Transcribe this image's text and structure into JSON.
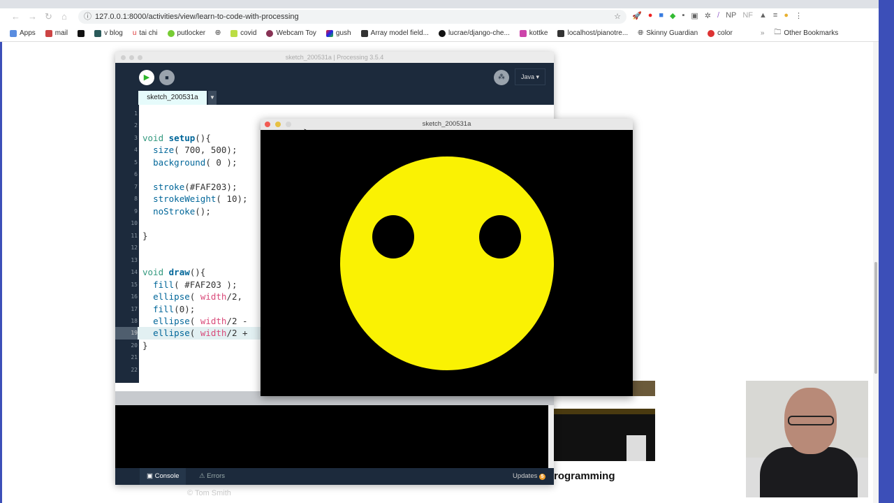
{
  "browser": {
    "url": "127.0.0.1:8000/activities/view/learn-to-code-with-processing",
    "bookmarks": [
      "Apps",
      "mail",
      "",
      "v blog",
      "tai chi",
      "putlocker",
      "",
      "covid",
      "Webcam Toy",
      "gush",
      "Array model field...",
      "lucrae/django-che...",
      "kottke",
      "localhost/pianotre...",
      "Skinny Guardian",
      "color"
    ],
    "more": "»",
    "other_bookmarks": "Other Bookmarks",
    "extensions": [
      "NP",
      "NF"
    ]
  },
  "processing": {
    "window_title": "sketch_200531a | Processing 3.5.4",
    "mode": "Java ▾",
    "tab": "sketch_200531a",
    "code": [
      [],
      [],
      [
        [
          "void ",
          "kw"
        ],
        [
          "setup",
          "fn"
        ],
        [
          "(){",
          ""
        ]
      ],
      [
        [
          "  ",
          ""
        ],
        [
          "size",
          "bi"
        ],
        [
          "( 700, 500);",
          ""
        ]
      ],
      [
        [
          "  ",
          ""
        ],
        [
          "background",
          "bi"
        ],
        [
          "( 0 );",
          ""
        ]
      ],
      [],
      [
        [
          "  ",
          ""
        ],
        [
          "stroke",
          "bi"
        ],
        [
          "(#FAF203);",
          ""
        ]
      ],
      [
        [
          "  ",
          ""
        ],
        [
          "strokeWeight",
          "bi"
        ],
        [
          "( 10);",
          ""
        ]
      ],
      [
        [
          "  ",
          ""
        ],
        [
          "noStroke",
          "bi"
        ],
        [
          "();",
          ""
        ]
      ],
      [],
      [
        [
          "}",
          ""
        ]
      ],
      [],
      [],
      [
        [
          "void ",
          "kw"
        ],
        [
          "draw",
          "fn"
        ],
        [
          "(){",
          ""
        ]
      ],
      [
        [
          "  ",
          ""
        ],
        [
          "fill",
          "bi"
        ],
        [
          "( #FAF203 );",
          ""
        ]
      ],
      [
        [
          "  ",
          ""
        ],
        [
          "ellipse",
          "bi"
        ],
        [
          "( ",
          ""
        ],
        [
          "width",
          "var"
        ],
        [
          "/2, ",
          ""
        ]
      ],
      [
        [
          "  ",
          ""
        ],
        [
          "fill",
          "bi"
        ],
        [
          "(0);",
          ""
        ]
      ],
      [
        [
          "  ",
          ""
        ],
        [
          "ellipse",
          "bi"
        ],
        [
          "( ",
          ""
        ],
        [
          "width",
          "var"
        ],
        [
          "/2 -",
          ""
        ]
      ],
      [
        [
          "  ",
          ""
        ],
        [
          "ellipse",
          "bi"
        ],
        [
          "( ",
          ""
        ],
        [
          "width",
          "var"
        ],
        [
          "/2 +",
          ""
        ]
      ],
      [
        [
          "}",
          ""
        ]
      ],
      [],
      []
    ],
    "highlighted_line": 19,
    "console_tab": "Console",
    "errors_tab": "Errors",
    "updates": "Updates",
    "updates_count": "5"
  },
  "sketch": {
    "title": "sketch_200531a",
    "face_color": "#FAF203"
  },
  "page": {
    "heading": "rogramming",
    "copyright": "© Tom Smith"
  }
}
